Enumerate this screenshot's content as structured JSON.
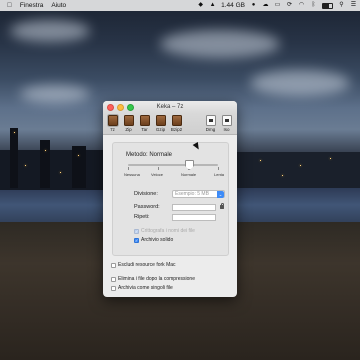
{
  "menubar": {
    "apple_icon": "apple-icon",
    "items": [
      "Finestra",
      "Aiuto"
    ],
    "memory": "1.44 GB",
    "status_icons": [
      "dropbox-icon",
      "volume-icon",
      "battery-icon",
      "user-icon",
      "cloud-icon",
      "display-icon",
      "sync-icon",
      "wifi-icon",
      "bluetooth-icon",
      "spotlight-icon",
      "notification-icon"
    ]
  },
  "window": {
    "title": "Keka – 7z",
    "formats": [
      {
        "label": "7z",
        "selected": true
      },
      {
        "label": "Zip"
      },
      {
        "label": "Tar"
      },
      {
        "label": "Gzip"
      },
      {
        "label": "Bzip2"
      }
    ],
    "extra": [
      {
        "label": "Dmg"
      },
      {
        "label": "Iso"
      }
    ],
    "method_label": "Metodo: Normale",
    "method_levels": [
      "Nessuna",
      "Veloce",
      "Normale",
      "Lenta"
    ],
    "method_value_fraction": 0.66,
    "division_label": "Divisione:",
    "division_placeholder": "Esempio: 5 MB",
    "password_label": "Password:",
    "password_value": "",
    "repeat_label": "Ripeti:",
    "repeat_value": "",
    "encrypt_names_label": "Crittografa i nomi dei file",
    "solid_archive_label": "Archivio solido",
    "exclude_fork_label": "Escludi resource fork Mac",
    "delete_after_label": "Elimina i file dopo la compressione",
    "archive_separately_label": "Archivia come singoli file"
  },
  "colors": {
    "accent": "#3d8bf7",
    "close": "#fc605b",
    "minimize": "#fdbc40",
    "zoom": "#34c84a"
  }
}
